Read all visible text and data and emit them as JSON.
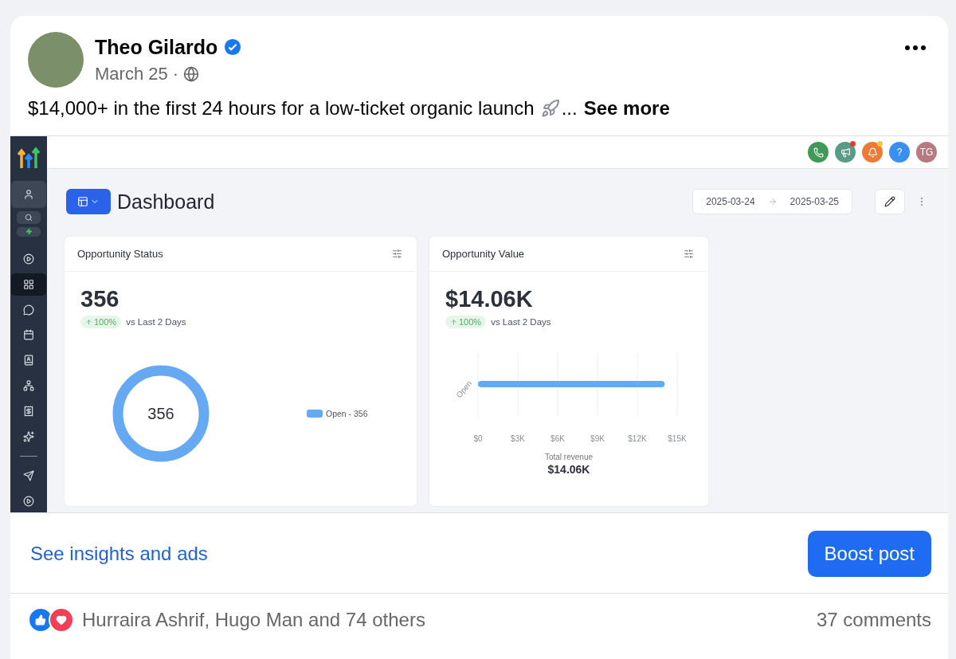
{
  "post": {
    "author": "Theo Gilardo",
    "verified": true,
    "date": "March 25",
    "separator": "·",
    "text": "$14,000+ in the first 24 hours for a low-ticket organic launch",
    "ellipsis": "...",
    "see_more": "See more"
  },
  "screenshot": {
    "topbar": [
      {
        "kind": "phone",
        "color": "#3f9a5a",
        "dot": false
      },
      {
        "kind": "megaphone",
        "color": "#5a9a86",
        "dot": true
      },
      {
        "kind": "bell",
        "color": "#ef7a35",
        "dot": true
      },
      {
        "kind": "help",
        "color": "#3b8ff0",
        "dot": false,
        "text": "?"
      },
      {
        "kind": "avatar",
        "color": "#b77a80",
        "dot": false,
        "text": "TG"
      }
    ],
    "sidebar": {
      "items": [
        {
          "selected": false
        },
        {
          "selected": true
        },
        {
          "selected": false
        },
        {
          "selected": false
        },
        {
          "selected": false
        },
        {
          "selected": false
        },
        {
          "selected": false
        },
        {
          "selected": false
        },
        {
          "selected": false
        },
        {
          "selected": false
        }
      ]
    },
    "title": "Dashboard",
    "date_from": "2025-03-24",
    "date_to": "2025-03-25",
    "cards": [
      {
        "kind": "donut",
        "title": "Opportunity Status",
        "value": "356",
        "change": "100%",
        "compare": "vs Last 2 Days",
        "center": "356",
        "legend": "Open - 356"
      },
      {
        "kind": "bar",
        "title": "Opportunity Value",
        "value": "$14.06K",
        "change": "100%",
        "compare": "vs Last 2 Days",
        "total_label": "Total revenue",
        "total_value": "$14.06K",
        "chart_data": {
          "type": "bar",
          "orientation": "horizontal",
          "grid": true,
          "categories": [
            "Open"
          ],
          "values": [
            14060
          ],
          "xlim": [
            0,
            15000
          ],
          "xticks": [
            {
              "value": 0,
              "label": "$0"
            },
            {
              "value": 3000,
              "label": "$3K"
            },
            {
              "value": 6000,
              "label": "$6K"
            },
            {
              "value": 9000,
              "label": "$9K"
            },
            {
              "value": 12000,
              "label": "$12K"
            },
            {
              "value": 15000,
              "label": "$15K"
            }
          ]
        }
      }
    ]
  },
  "footer": {
    "insights_link": "See insights and ads",
    "boost_button": "Boost post"
  },
  "reactions": {
    "names": "Hurraira Ashrif, Hugo Man and 74 others",
    "comments": "37 comments"
  }
}
